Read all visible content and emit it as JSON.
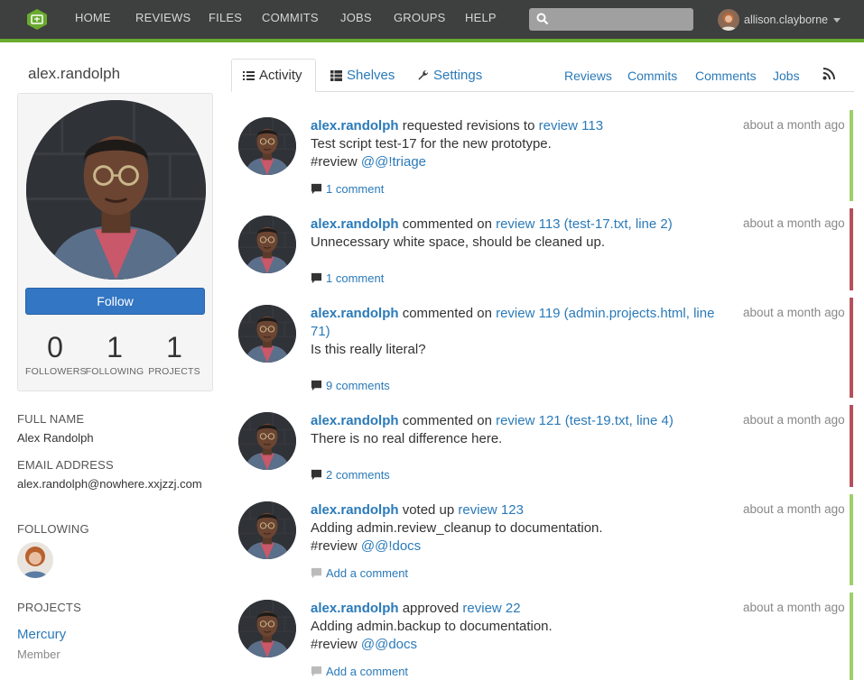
{
  "nav": {
    "items": [
      "HOME",
      "REVIEWS",
      "FILES",
      "COMMITS",
      "JOBS",
      "GROUPS",
      "HELP"
    ],
    "search_placeholder": "",
    "user": "allison.clayborne"
  },
  "profile": {
    "username": "alex.randolph",
    "follow_label": "Follow",
    "stats": [
      {
        "value": "0",
        "label": "FOLLOWERS"
      },
      {
        "value": "1",
        "label": "FOLLOWING"
      },
      {
        "value": "1",
        "label": "PROJECTS"
      }
    ],
    "full_name_heading": "FULL NAME",
    "full_name": "Alex Randolph",
    "email_heading": "EMAIL ADDRESS",
    "email": "alex.randolph@nowhere.xxjzzj.com",
    "following_heading": "FOLLOWING",
    "projects_heading": "PROJECTS",
    "project_name": "Mercury",
    "project_role": "Member"
  },
  "tabs": {
    "activity": "Activity",
    "shelves": "Shelves",
    "settings": "Settings",
    "right": [
      "Reviews",
      "Commits",
      "Comments",
      "Jobs"
    ]
  },
  "activity": [
    {
      "user": "alex.randolph",
      "action": " requested revisions to ",
      "target": "review 113",
      "text": "Test script test-17 for the new prototype.",
      "tag_prefix": "#review ",
      "tag": "@@!triage",
      "time": "about a month ago",
      "comments": "1 comment",
      "status_color": "#9fcf6b"
    },
    {
      "user": "alex.randolph",
      "action": " commented on ",
      "target": "review 113 (test-17.txt, line 2)",
      "text": "Unnecessary white space, should be cleaned up.",
      "tag_prefix": "",
      "tag": "",
      "time": "about a month ago",
      "comments": "1 comment",
      "status_color": "#b5505c"
    },
    {
      "user": "alex.randolph",
      "action": " commented on ",
      "target": "review 119 (admin.projects.html, line 71)",
      "text": "Is this really literal?",
      "tag_prefix": "",
      "tag": "",
      "time": "about a month ago",
      "comments": "9 comments",
      "status_color": "#b5505c"
    },
    {
      "user": "alex.randolph",
      "action": " commented on ",
      "target": "review 121 (test-19.txt, line 4)",
      "text": "There is no real difference here.",
      "tag_prefix": "",
      "tag": "",
      "time": "about a month ago",
      "comments": "2 comments",
      "status_color": "#b5505c"
    },
    {
      "user": "alex.randolph",
      "action": " voted up ",
      "target": "review 123",
      "text": "Adding admin.review_cleanup to documentation.",
      "tag_prefix": "#review ",
      "tag": "@@!docs",
      "time": "about a month ago",
      "comments": "Add a comment",
      "status_color": "#9fcf6b"
    },
    {
      "user": "alex.randolph",
      "action": " approved ",
      "target": "review 22",
      "text": "Adding admin.backup to documentation.",
      "tag_prefix": "#review ",
      "tag": "@@docs",
      "time": "about a month ago",
      "comments": "Add a comment",
      "status_color": "#9fcf6b"
    }
  ]
}
